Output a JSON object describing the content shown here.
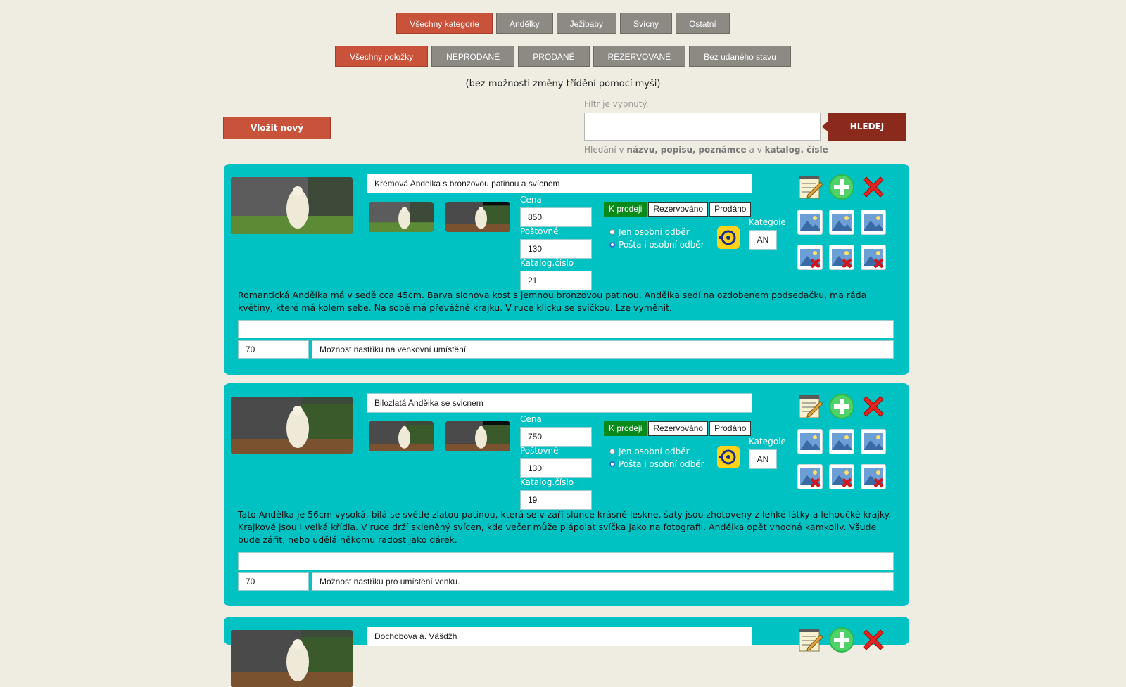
{
  "categories": {
    "tabs": [
      "Všechny kategorie",
      "Andělky",
      "Ježibaby",
      "Svícny",
      "Ostatní"
    ]
  },
  "states": {
    "tabs": [
      "Všechny položky",
      "NEPRODANÉ",
      "PRODANÉ",
      "REZERVOVANÉ",
      "Bez udaného stavu"
    ]
  },
  "sort_hint": "(bez možnosti změny třídění pomocí myši)",
  "new_button": "Vložit nový",
  "filter": {
    "status": "Filtr je vypnutý.",
    "search_value": "",
    "search_button": "HLEDEJ",
    "help_prefix": "Hledání v",
    "help_f1": "názvu",
    "help_f2": "popisu",
    "help_f3": "poznámce",
    "help_and": "a v",
    "help_f4": "katalog. čísle"
  },
  "labels": {
    "price": "Cena",
    "shipping": "Poštovné",
    "catalog": "Katalog.číslo",
    "status_sale": "K prodeji",
    "status_reserved": "Rezervováno",
    "status_sold": "Prodáno",
    "pickup_only": "Jen osobní odběr",
    "post_and_pickup": "Pošta i osobní odběr",
    "category": "Kategoie"
  },
  "items": [
    {
      "title": "Krémová Andelka s bronzovou patinou a svícnem",
      "price": "850",
      "shipping": "130",
      "catalog": "21",
      "category": "AN",
      "description": "Romantická Andělka má v sedě cca 45cm. Barva slonova kost s jemnou bronzovou patinou. Andělka sedí na ozdobenem podsedačku, ma ráda květiny, které má kolem sebe. Na sobě má převážně krajku. V ruce klícku se svíčkou. Lze vyměnit.",
      "note": "",
      "extra_price": "70",
      "extra_text": "Moznost nastřiku na venkovní umístění"
    },
    {
      "title": "Bilozlatá Andělka se svicnem",
      "price": "750",
      "shipping": "130",
      "catalog": "19",
      "category": "AN",
      "description": "Tato Andělka je 56cm vysoká, bílá se světle zlatou patinou, která se v zaří slunce krásně leskne, šaty jsou zhotoveny z lehké látky a lehoučké krajky. Krajkové jsou i velká křídla. V ruce drží skleněný svícen, kde večer může plápolat svíčka jako na fotografii. Andělka opět vhodná kamkoliv. Všude bude zářit, nebo udělá někomu radost jako dárek.",
      "note": "",
      "extra_price": "70",
      "extra_text": "Možnost nastřiku pro umístění venku."
    },
    {
      "title": "Dochobova a. Vášdžh"
    }
  ],
  "colors": {
    "background": "#efece1",
    "card": "#00c2c2",
    "active_tab": "#c9523a",
    "inactive_tab": "#8c8a82",
    "search_button": "#8a2a1c",
    "status_on": "#0a8a1a"
  },
  "icons": [
    "notepad-edit-icon",
    "add-plus-icon",
    "delete-x-icon",
    "image-icon",
    "image-delete-icon",
    "post-horn-icon"
  ]
}
